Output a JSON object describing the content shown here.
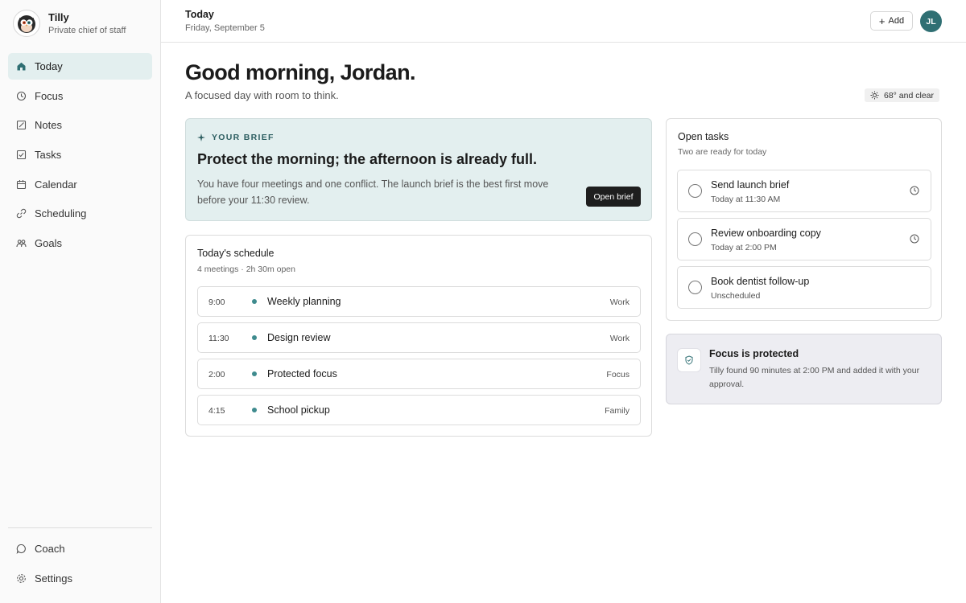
{
  "sidebar": {
    "brand": {
      "name": "Tilly",
      "tagline": "Private chief of staff"
    },
    "items": [
      {
        "label": "Today",
        "icon": "home-icon",
        "active": true
      },
      {
        "label": "Focus",
        "icon": "focus-icon",
        "active": false
      },
      {
        "label": "Notes",
        "icon": "notes-icon",
        "active": false
      },
      {
        "label": "Tasks",
        "icon": "tasks-icon",
        "active": false
      },
      {
        "label": "Calendar",
        "icon": "calendar-icon",
        "active": false
      },
      {
        "label": "Scheduling",
        "icon": "link-icon",
        "active": false
      },
      {
        "label": "Goals",
        "icon": "goals-icon",
        "active": false
      }
    ],
    "bottom": [
      {
        "label": "Coach",
        "icon": "chat-icon"
      },
      {
        "label": "Settings",
        "icon": "settings-icon"
      }
    ]
  },
  "header": {
    "title": "Today",
    "date": "Friday, September 5",
    "add_label": "Add",
    "avatar_initials": "JL"
  },
  "main": {
    "greeting": "Good morning, Jordan.",
    "subtitle": "A focused day with room to think.",
    "weather": "68° and clear",
    "brief": {
      "label": "YOUR BRIEF",
      "title": "Protect the morning; the afternoon is already full.",
      "body": "You have four meetings and one conflict. The launch brief is the best first move before your 11:30 review.",
      "button": "Open brief"
    },
    "schedule": {
      "title": "Today's schedule",
      "summary": "4 meetings · 2h 30m open",
      "items": [
        {
          "time": "9:00",
          "name": "Weekly planning",
          "tag": "Work"
        },
        {
          "time": "11:30",
          "name": "Design review",
          "tag": "Work"
        },
        {
          "time": "2:00",
          "name": "Protected focus",
          "tag": "Focus"
        },
        {
          "time": "4:15",
          "name": "School pickup",
          "tag": "Family"
        }
      ]
    },
    "tasks": {
      "title": "Open tasks",
      "subtitle": "Two are ready for today",
      "items": [
        {
          "name": "Send launch brief",
          "when": "Today at 11:30 AM"
        },
        {
          "name": "Review onboarding copy",
          "when": "Today at 2:00 PM"
        },
        {
          "name": "Book dentist follow-up",
          "when": "Unscheduled"
        }
      ]
    },
    "focus": {
      "title": "Focus is protected",
      "body": "Tilly found 90 minutes at 2:00 PM and added it with your approval."
    }
  },
  "colors": {
    "accent": "#2f6f73",
    "brief_bg": "#e3efef",
    "dot": "#3f8b8e"
  }
}
